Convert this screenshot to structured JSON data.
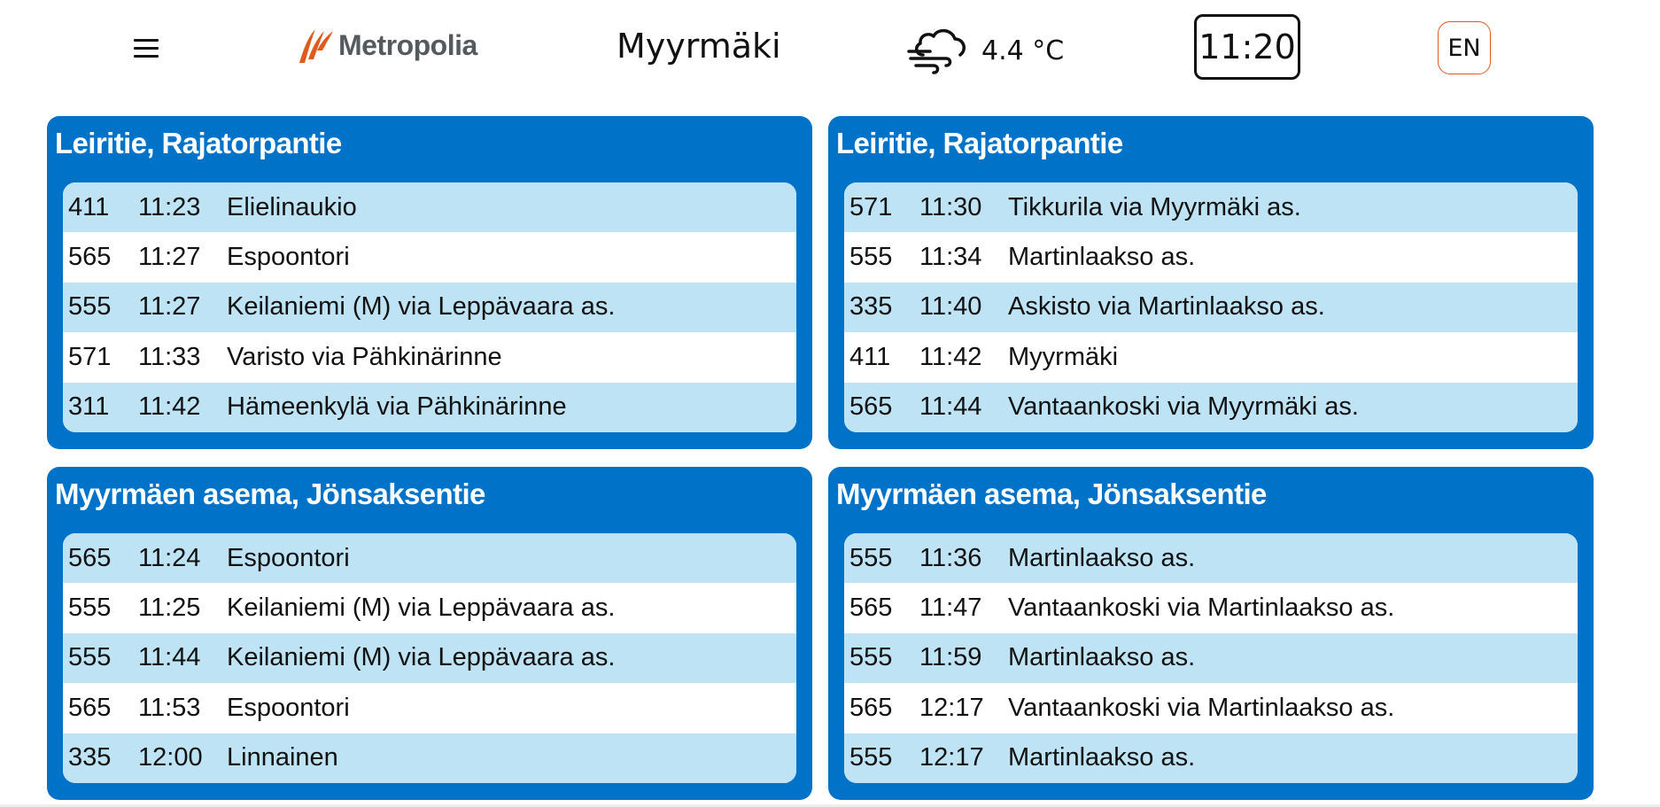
{
  "header": {
    "menu_icon": "hamburger-menu-icon",
    "logo_text": "Metropolia",
    "location": "Myyrmäki",
    "weather_icon": "cloud-wind-icon",
    "temperature": "4.4 °C",
    "clock": "11:20",
    "language": "EN",
    "accent_color": "#e05a1c"
  },
  "colors": {
    "panel_bg": "#0073c9",
    "row_alt": "#bde3f5",
    "row": "#ffffff"
  },
  "panels": [
    {
      "title": "Leiritie, Rajatorpantie",
      "departures": [
        {
          "route": "411",
          "time": "11:23",
          "destination": "Elielinaukio"
        },
        {
          "route": "565",
          "time": "11:27",
          "destination": "Espoontori"
        },
        {
          "route": "555",
          "time": "11:27",
          "destination": "Keilaniemi (M) via Leppävaara as."
        },
        {
          "route": "571",
          "time": "11:33",
          "destination": "Varisto via Pähkinärinne"
        },
        {
          "route": "311",
          "time": "11:42",
          "destination": "Hämeenkylä via Pähkinärinne"
        }
      ]
    },
    {
      "title": "Leiritie, Rajatorpantie",
      "departures": [
        {
          "route": "571",
          "time": "11:30",
          "destination": "Tikkurila via Myyrmäki as."
        },
        {
          "route": "555",
          "time": "11:34",
          "destination": "Martinlaakso as."
        },
        {
          "route": "335",
          "time": "11:40",
          "destination": "Askisto via Martinlaakso as."
        },
        {
          "route": "411",
          "time": "11:42",
          "destination": "Myyrmäki"
        },
        {
          "route": "565",
          "time": "11:44",
          "destination": "Vantaankoski via Myyrmäki as."
        }
      ]
    },
    {
      "title": "Myyrmäen asema, Jönsaksentie",
      "departures": [
        {
          "route": "565",
          "time": "11:24",
          "destination": "Espoontori"
        },
        {
          "route": "555",
          "time": "11:25",
          "destination": "Keilaniemi (M) via Leppävaara as."
        },
        {
          "route": "555",
          "time": "11:44",
          "destination": "Keilaniemi (M) via Leppävaara as."
        },
        {
          "route": "565",
          "time": "11:53",
          "destination": "Espoontori"
        },
        {
          "route": "335",
          "time": "12:00",
          "destination": "Linnainen"
        }
      ]
    },
    {
      "title": "Myyrmäen asema, Jönsaksentie",
      "departures": [
        {
          "route": "555",
          "time": "11:36",
          "destination": "Martinlaakso as."
        },
        {
          "route": "565",
          "time": "11:47",
          "destination": "Vantaankoski via Martinlaakso as."
        },
        {
          "route": "555",
          "time": "11:59",
          "destination": "Martinlaakso as."
        },
        {
          "route": "565",
          "time": "12:17",
          "destination": "Vantaankoski via Martinlaakso as."
        },
        {
          "route": "555",
          "time": "12:17",
          "destination": "Martinlaakso as."
        }
      ]
    }
  ]
}
